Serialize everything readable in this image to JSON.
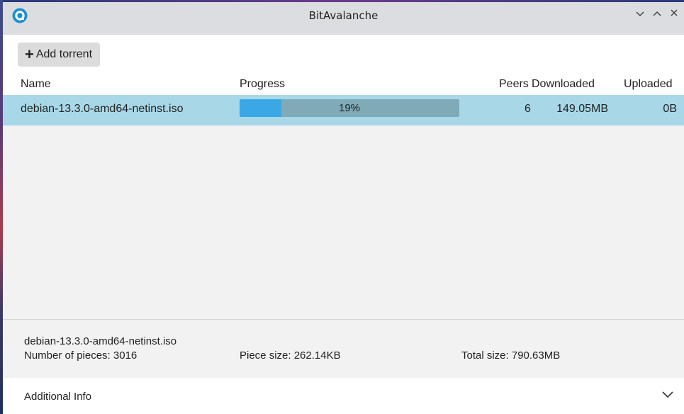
{
  "window": {
    "title": "BitAvalanche",
    "icon": "bitavalanche-logo-icon",
    "controls": {
      "minimize": "⌄",
      "maximize": "⌃",
      "close": "✕"
    }
  },
  "toolbar": {
    "add_icon": "+",
    "add_label": "Add torrent"
  },
  "list": {
    "columns": {
      "name": "Name",
      "progress": "Progress",
      "peers": "Peers",
      "downloaded": "Downloaded",
      "uploaded": "Uploaded"
    },
    "rows": [
      {
        "name": "debian-13.3.0-amd64-netinst.iso",
        "progress_text": "19%",
        "progress_value": 0.19,
        "peers": "6",
        "downloaded": "149.05MB",
        "uploaded": "0B"
      }
    ]
  },
  "details": {
    "filename": "debian-13.3.0-amd64-netinst.iso",
    "pieces": "Number of pieces: 3016",
    "piece_size": "Piece size: 262.14KB",
    "total_size": "Total size: 790.63MB"
  },
  "additional_info": {
    "label": "Additional Info",
    "icon": "chevron-down-icon"
  },
  "colors": {
    "selected_row": "#a8d8e8",
    "progress_fill": "#3aa8e6",
    "progress_track": "#7faab8",
    "accent": "#1a8fd0"
  }
}
